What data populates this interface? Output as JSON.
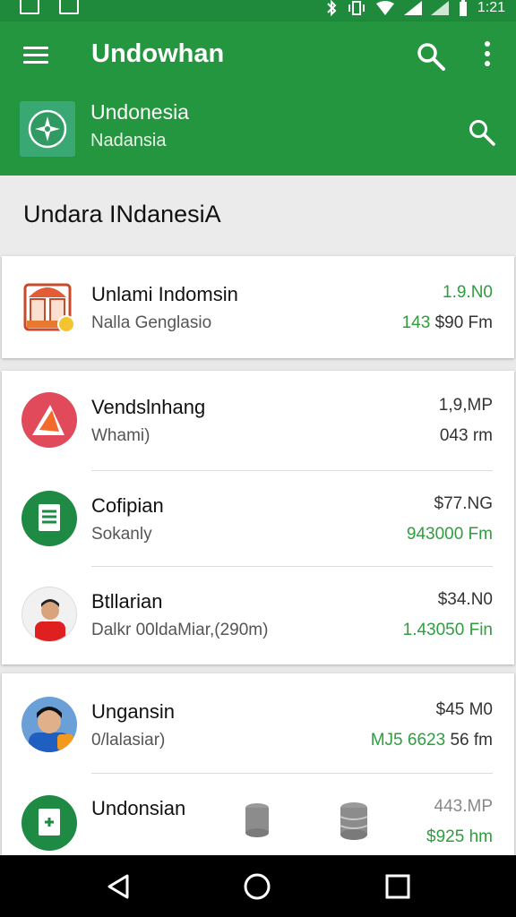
{
  "status_bar": {
    "time": "1:21"
  },
  "app_bar": {
    "title": "Undowhan",
    "account_name": "Undonesia",
    "account_sub": "Nadansia"
  },
  "section": {
    "title": "Undara INdanesiA"
  },
  "cards": [
    {
      "rows": [
        {
          "name": "Unlami Indomsin",
          "sub": "Nalla Genglasio",
          "value_top": "1.9.N0",
          "value_bottom_green": "143",
          "value_bottom": " $90 Fm",
          "avatar": "shop-icon"
        }
      ]
    },
    {
      "rows": [
        {
          "name": "Vendslnhang",
          "sub": "Whami)",
          "value_top": "1,9,MP",
          "value_bottom": "043 rm",
          "avatar": "red-logo-icon"
        },
        {
          "name": "Cofipian",
          "sub": "Sokanly",
          "value_top": "$77.NG",
          "value_bottom": "943000 Fm",
          "avatar": "document-icon"
        },
        {
          "name": "Btllarian",
          "sub": "Dalkr 00ldaMiar,(290m)",
          "value_top": "$34.N0",
          "value_bottom": "1.43050 Fin",
          "avatar": "person-avatar"
        }
      ]
    },
    {
      "rows": [
        {
          "name": "Ungansin",
          "sub": "0/lalasiar)",
          "value_top": "$45 M0",
          "value_bottom_green": "MJ5 6623",
          "value_bottom": " 56 fm",
          "avatar": "person-avatar"
        },
        {
          "name": "Undonsian",
          "sub": "",
          "value_top": "443.MP",
          "value_bottom": "$925 hm",
          "avatar": "add-document-icon"
        }
      ]
    }
  ],
  "colors": {
    "primary": "#23963f",
    "accent_green": "#2e9e3e",
    "nav": "#000000"
  },
  "nav_bar": {
    "icons": [
      "back-icon",
      "home-icon",
      "recents-icon"
    ]
  }
}
